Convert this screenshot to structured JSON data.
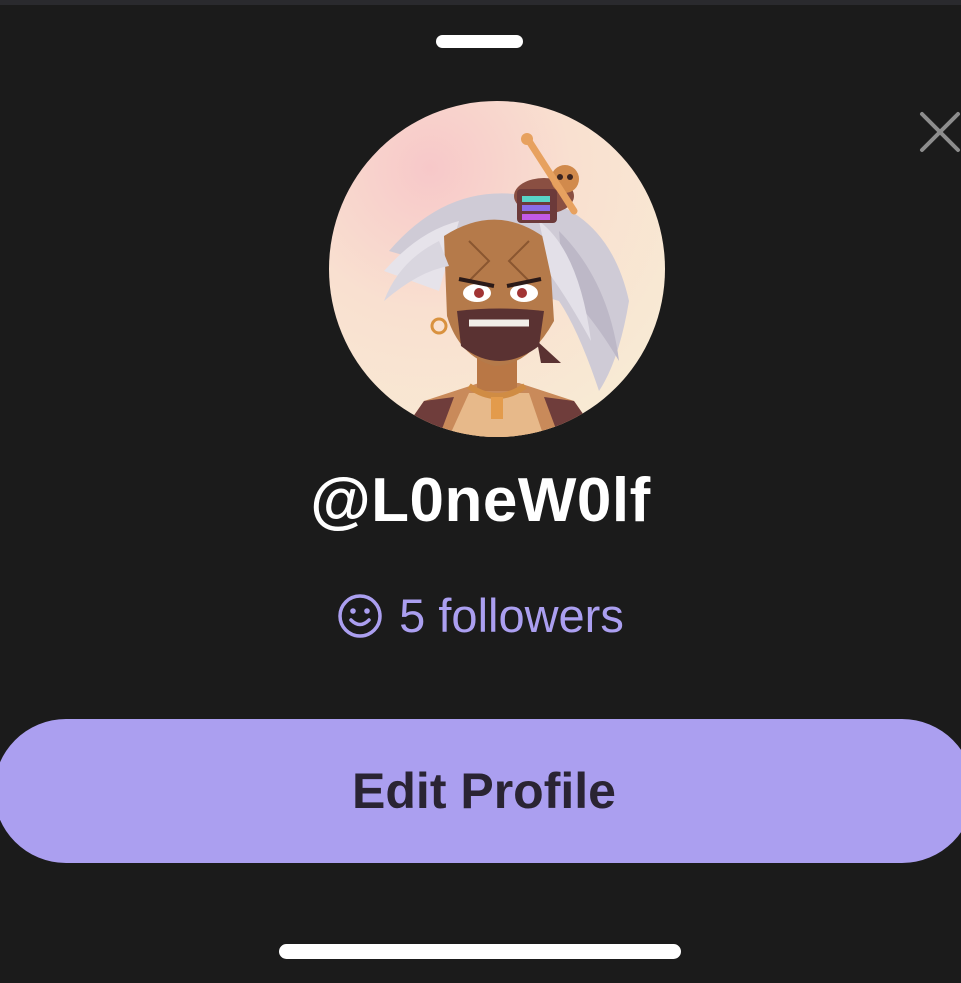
{
  "profile": {
    "username": "@L0neW0lf",
    "followers_text": "5 followers",
    "avatar_description_icon": "avatar-image"
  },
  "actions": {
    "edit_profile_label": "Edit Profile"
  },
  "icons": {
    "close": "close-icon",
    "followers": "smiley-icon"
  },
  "colors": {
    "background": "#1b1b1b",
    "accent": "#ab9ff0",
    "button_text": "#2a2433",
    "text_primary": "#ffffff"
  }
}
